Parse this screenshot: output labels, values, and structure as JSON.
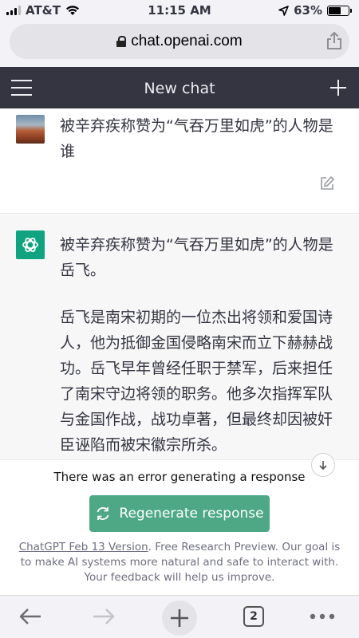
{
  "status_bar": {
    "carrier": "AT&T",
    "time": "11:15 AM",
    "battery_percent_label": "63%",
    "battery_level": 0.63
  },
  "browser": {
    "url": "chat.openai.com",
    "tabs_count": "2"
  },
  "chat": {
    "title": "New chat",
    "user_message": "被辛弃疾称赞为“气吞万里如虎”的人物是谁",
    "assistant_paragraphs": [
      "被辛弃疾称赞为“气吞万里如虎”的人物是岳飞。",
      "岳飞是南宋初期的一位杰出将领和爱国诗人，他为抵御金国侵略南宋而立下赫赫战功。岳飞早年曾经任职于禁军，后来担任了南宋守边将领的职务。他多次指挥军队与金国作战，战功卓著，但最终却因被奸臣诬陷而被宋徽宗所杀。"
    ]
  },
  "bottom": {
    "error_text": "There was an error generating a response",
    "regenerate_label": "Regenerate response",
    "footer_link": "ChatGPT Feb 13 Version",
    "footer_text": ". Free Research Preview. Our goal is to make AI systems more natural and safe to interact with. Your feedback will help us improve."
  },
  "colors": {
    "header_bg": "#343541",
    "assistant_bg": "#f7f7f8",
    "accent_green": "#10a37f",
    "regenerate_bg": "#4ea886"
  },
  "icons": {
    "menu": "hamburger-icon",
    "new_chat": "plus-icon",
    "edit": "edit-icon",
    "regenerate": "refresh-icon",
    "scroll_down": "arrow-down-icon",
    "share": "share-icon",
    "lock": "lock-icon"
  }
}
